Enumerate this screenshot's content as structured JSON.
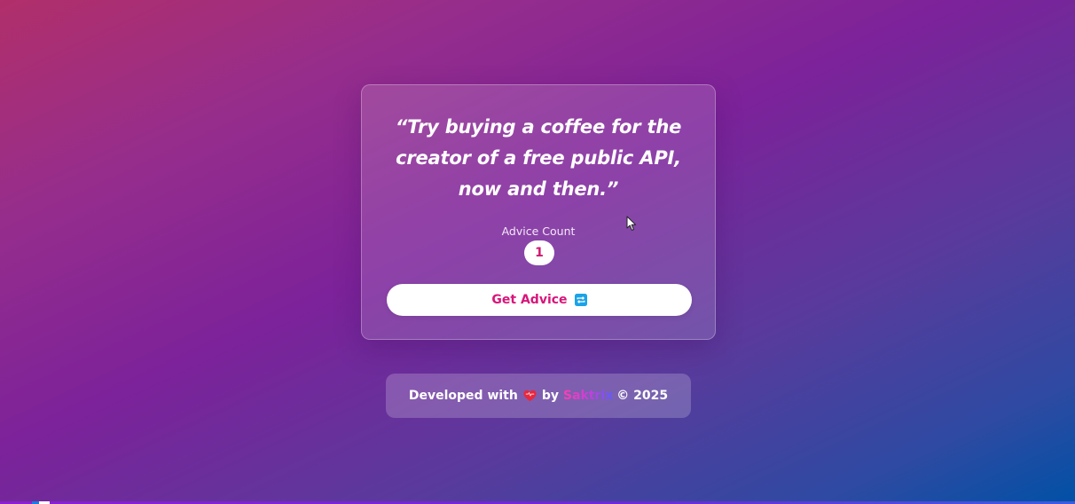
{
  "advice": {
    "quote": "“Try buying a coffee for the creator of a free public API, now and then.”",
    "count_label": "Advice Count",
    "count_value": "1"
  },
  "button": {
    "label": "Get Advice",
    "icon": "repeat-icon"
  },
  "footer": {
    "prefix": "Developed with",
    "heart_icon": "heart-icon",
    "by": "by",
    "author": "Saktrix",
    "copyright": "© 2025"
  },
  "colors": {
    "accent": "#d8157a",
    "badge_text": "#d1176f",
    "icon_blue": "#1aa3e8",
    "heart_red": "#e8283c"
  }
}
